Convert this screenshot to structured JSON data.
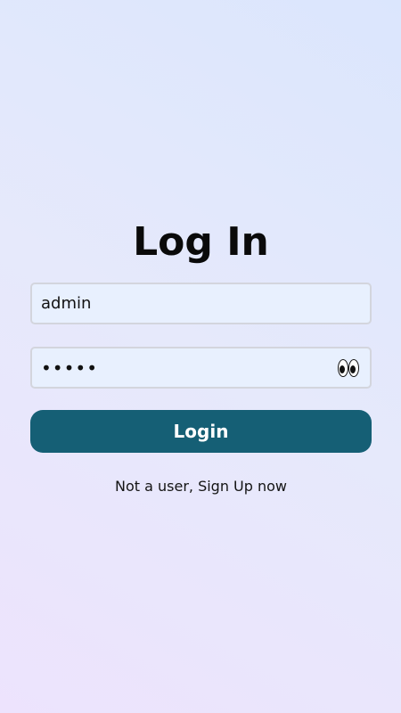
{
  "login": {
    "title": "Log In",
    "username": {
      "value": "admin",
      "placeholder": ""
    },
    "password": {
      "value": "•••••",
      "placeholder": ""
    },
    "show_password_icon": "eyes-icon",
    "submit_label": "Login",
    "signup_text": "Not a user, Sign Up now"
  },
  "colors": {
    "button": "#155f75",
    "field_background": "#e8f0fe",
    "field_border": "#d3d5dd",
    "background_start": "#ede3fd",
    "background_end": "#dbe6fd"
  }
}
